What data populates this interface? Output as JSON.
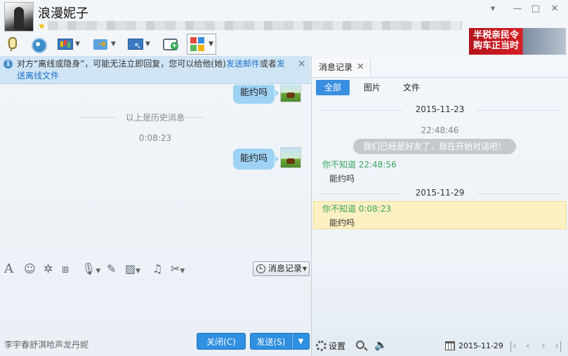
{
  "window": {
    "contact_name": "浪漫妮子",
    "controls": {
      "menu": "▾",
      "minimize": "—",
      "maximize": "□",
      "close": "✕"
    }
  },
  "ad": {
    "line1": "半税亲民令",
    "line2": "购车正当时"
  },
  "toolbar": {
    "icons": [
      "mic-icon",
      "camera-icon",
      "screen-share-icon",
      "file-transfer-icon",
      "remote-desktop-icon",
      "new-message-icon",
      "apps-icon"
    ]
  },
  "notice": {
    "text_before": "对方“离线或隐身”，可能无法立即回复，您可以给他(她)",
    "link_email": "发送邮件",
    "text_middle": "或者",
    "link_offline_file": "发送离线文件"
  },
  "chat": {
    "bubble_1": "能约吗",
    "history_divider": "以上是历史消息",
    "time_1": "0:08:23",
    "bubble_2": "能约吗"
  },
  "input_toolbar": {
    "history_button": "消息记录"
  },
  "bottom": {
    "status_text": "李宇春舒淇哈声龙丹妮",
    "close_button": "关闭(C)",
    "send_button": "发送(S)"
  },
  "history_panel": {
    "tab_label": "消息记录",
    "filters": [
      "全部",
      "图片",
      "文件"
    ],
    "date_1": "2015-11-23",
    "sys_time": "22:48:46",
    "sys_message": "我们已经是好友了，现在开始对话吧！",
    "msg_1_sender": "你不知道",
    "msg_1_time": "22:48:56",
    "msg_1_text": "能约吗",
    "date_2": "2015-11-29",
    "msg_2_sender": "你不知道",
    "msg_2_time": "0:08:23",
    "msg_2_text": "能约吗",
    "settings_label": "设置",
    "calendar_date": "2015-11-29"
  }
}
